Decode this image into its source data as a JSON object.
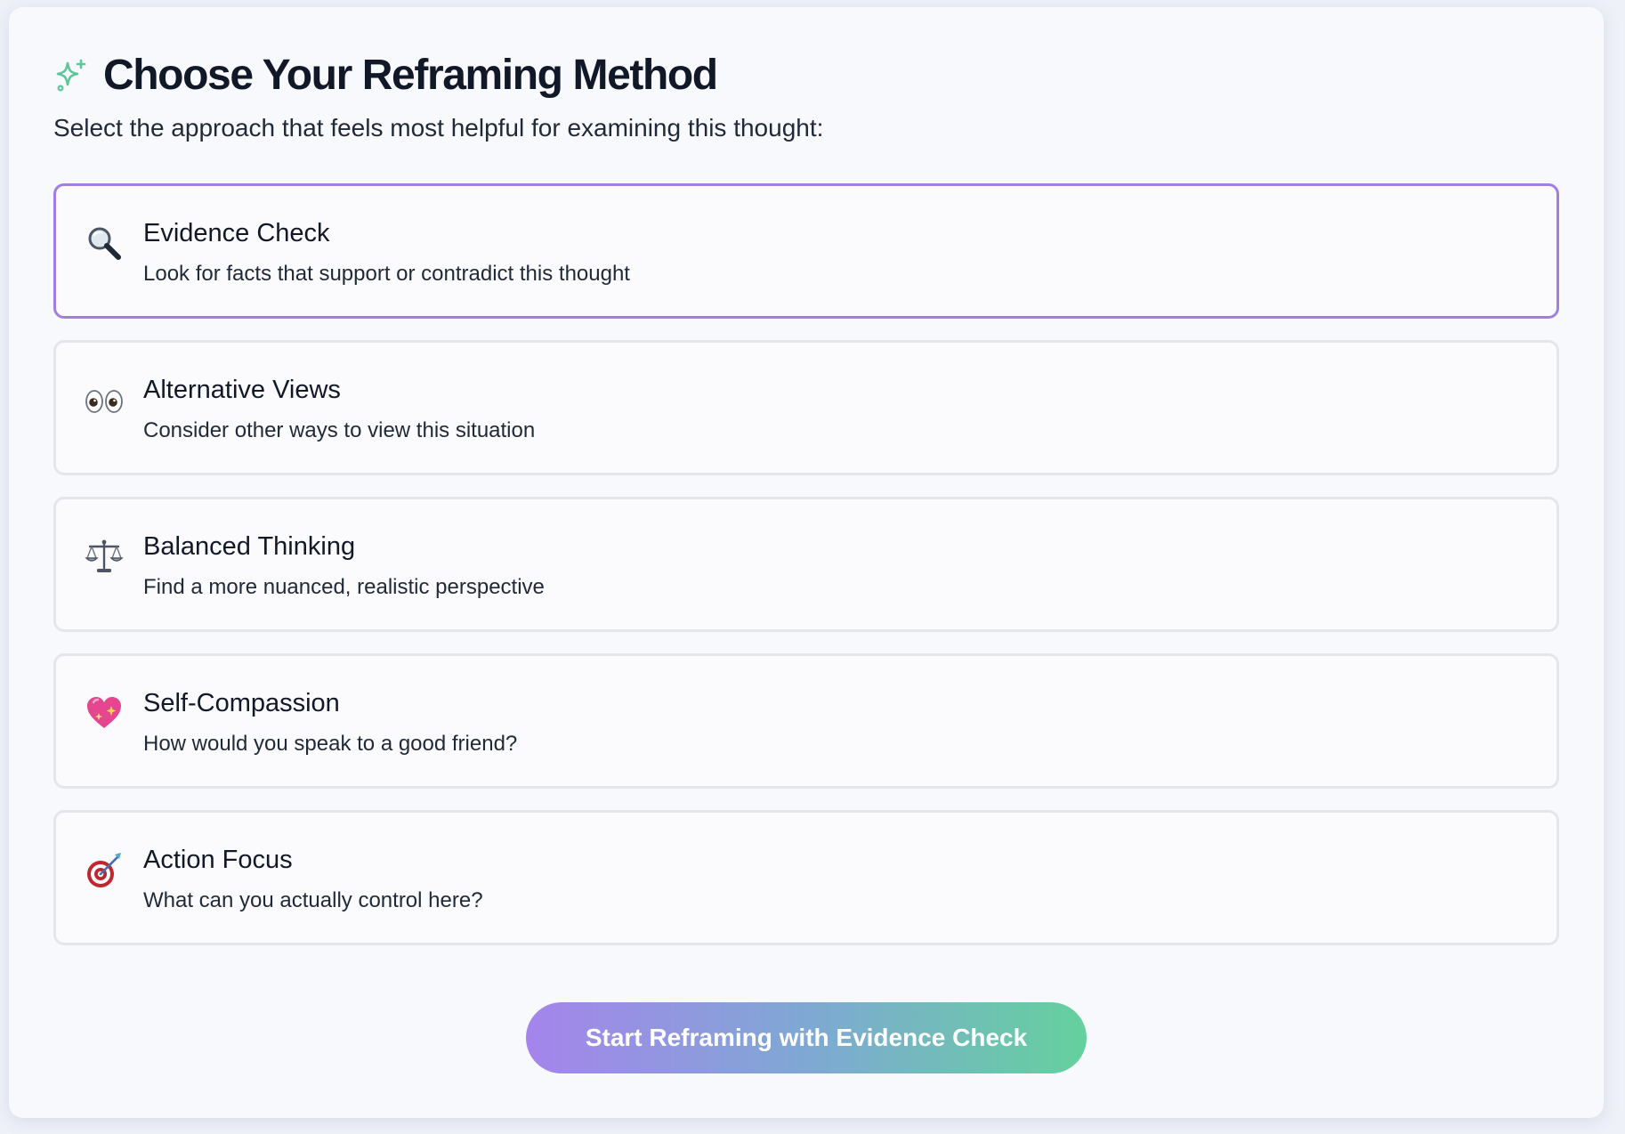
{
  "header": {
    "icon": "sparkle-icon",
    "title": "Choose Your Reframing Method",
    "subtitle": "Select the approach that feels most helpful for examining this thought:"
  },
  "options": [
    {
      "icon": "magnifying-glass-icon",
      "title": "Evidence Check",
      "description": "Look for facts that support or contradict this thought",
      "selected": true
    },
    {
      "icon": "eyes-icon",
      "title": "Alternative Views",
      "description": "Consider other ways to view this situation",
      "selected": false
    },
    {
      "icon": "balance-scale-icon",
      "title": "Balanced Thinking",
      "description": "Find a more nuanced, realistic perspective",
      "selected": false
    },
    {
      "icon": "sparkling-heart-icon",
      "title": "Self-Compassion",
      "description": "How would you speak to a good friend?",
      "selected": false
    },
    {
      "icon": "target-icon",
      "title": "Action Focus",
      "description": "What can you actually control here?",
      "selected": false
    }
  ],
  "start_button": {
    "label": "Start Reframing with Evidence Check"
  },
  "colors": {
    "accent_purple": "#a07ee3",
    "accent_green": "#64d19d",
    "sparkle": "#5cc79a"
  }
}
